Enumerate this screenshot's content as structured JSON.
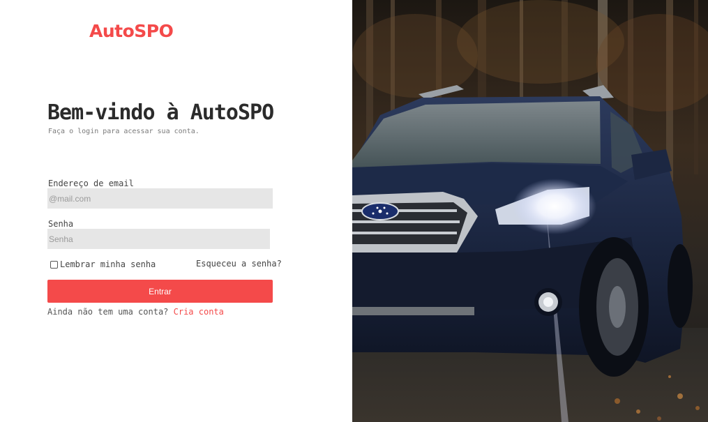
{
  "brand": {
    "logo_text": "AutoSPO",
    "color": "#f44a4a"
  },
  "header": {
    "title": "Bem-vindo à AutoSPO",
    "subtitle": "Faça o login para acessar sua conta."
  },
  "form": {
    "email": {
      "label": "Endereço de email",
      "placeholder": "@mail.com",
      "value": ""
    },
    "password": {
      "label": "Senha",
      "placeholder": "Senha",
      "value": ""
    },
    "remember": {
      "label": "Lembrar minha senha",
      "checked": false
    },
    "forgot_label": "Esqueceu a senha?",
    "submit_label": "Entrar"
  },
  "signup": {
    "prompt": "Ainda não tem uma conta?",
    "link_label": "Cria conta"
  },
  "hero": {
    "icon": "car-photo"
  }
}
